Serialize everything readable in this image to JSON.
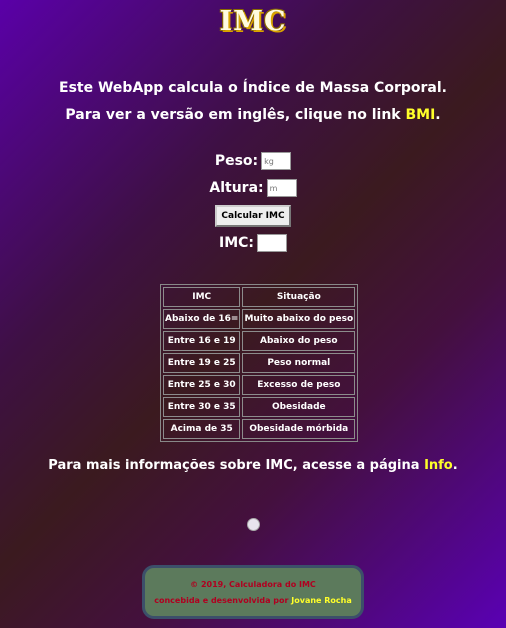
{
  "header": {
    "title": "IMC"
  },
  "intro": {
    "line1": "Este WebApp calcula o Índice de Massa Corporal.",
    "line2_prefix": "Para ver a versão em inglês, clique no link ",
    "line2_link": "BMI",
    "line2_suffix": "."
  },
  "form": {
    "peso_label": "Peso:",
    "peso_placeholder": "kg",
    "altura_label": "Altura:",
    "altura_placeholder": "m",
    "button_label": "Calcular IMC",
    "imc_label": "IMC:",
    "imc_value": ""
  },
  "table": {
    "headers": [
      "IMC",
      "Situação"
    ],
    "rows": [
      [
        "Abaixo de 16=",
        "Muito abaixo do peso"
      ],
      [
        "Entre 16 e 19",
        "Abaixo do peso"
      ],
      [
        "Entre 19 e 25",
        "Peso normal"
      ],
      [
        "Entre 25 e 30",
        "Excesso de peso"
      ],
      [
        "Entre 30 e 35",
        "Obesidade"
      ],
      [
        "Acima de 35",
        "Obesidade mórbida"
      ]
    ]
  },
  "more": {
    "prefix": "Para mais informações sobre IMC, acesse a página ",
    "link": "Info",
    "suffix": "."
  },
  "footer": {
    "line1": "© 2019, Calculadora do IMC",
    "line2_prefix": "concebida e desenvolvida por ",
    "author": "Jovane Rocha"
  },
  "colors": {
    "link": "#ffff2a",
    "footer_bg": "#5c7a5c",
    "footer_text": "#b00020"
  }
}
